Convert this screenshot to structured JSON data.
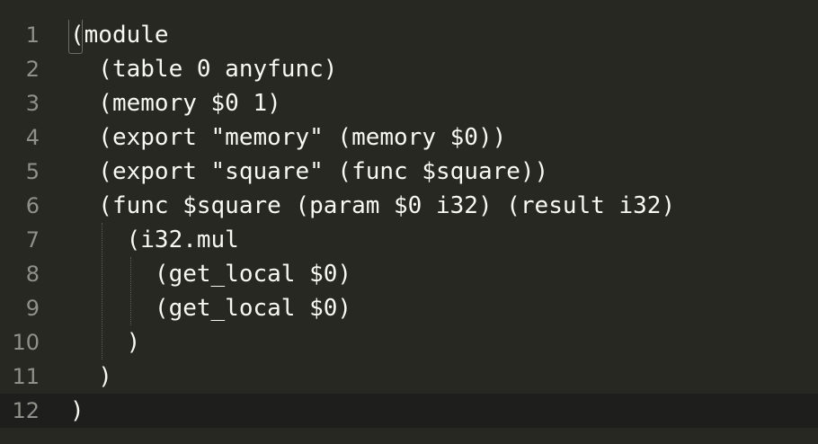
{
  "editor": {
    "lines": [
      {
        "number": "1",
        "text": "(module"
      },
      {
        "number": "2",
        "text": "  (table 0 anyfunc)"
      },
      {
        "number": "3",
        "text": "  (memory $0 1)"
      },
      {
        "number": "4",
        "text": "  (export \"memory\" (memory $0))"
      },
      {
        "number": "5",
        "text": "  (export \"square\" (func $square))"
      },
      {
        "number": "6",
        "text": "  (func $square (param $0 i32) (result i32)"
      },
      {
        "number": "7",
        "text": "    (i32.mul"
      },
      {
        "number": "8",
        "text": "      (get_local $0)"
      },
      {
        "number": "9",
        "text": "      (get_local $0)"
      },
      {
        "number": "10",
        "text": "    )"
      },
      {
        "number": "11",
        "text": "  )"
      },
      {
        "number": "12",
        "text": ")"
      }
    ],
    "active_line": 12,
    "colors": {
      "background": "#272822",
      "active_line": "#1e1f1c",
      "gutter_text": "#8f908a",
      "text": "#f8f8f2"
    }
  }
}
